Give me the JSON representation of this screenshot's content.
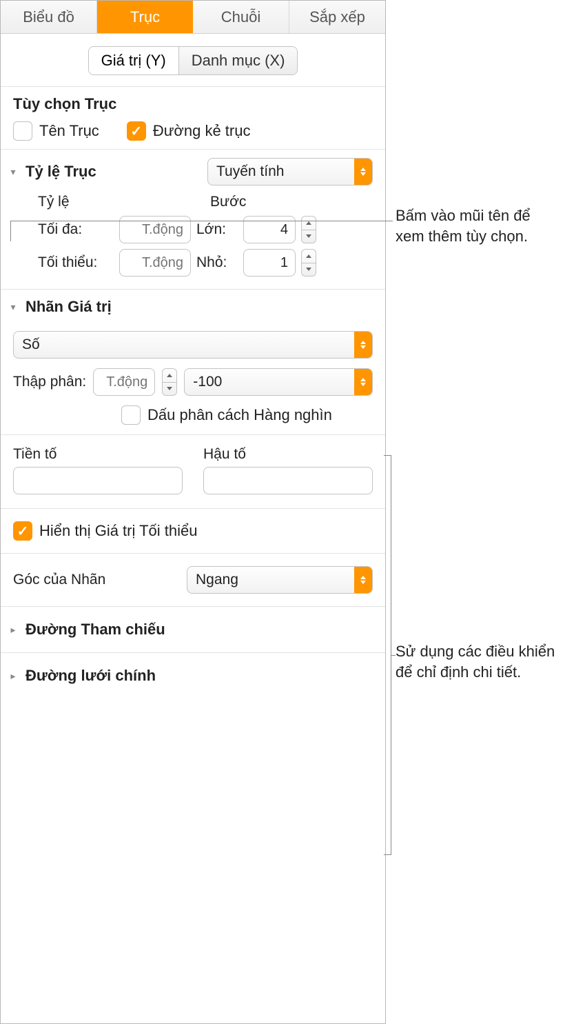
{
  "tabs": {
    "chart": "Biểu đồ",
    "axis": "Trục",
    "series": "Chuỗi",
    "sort": "Sắp xếp"
  },
  "segmented": {
    "value_y": "Giá trị (Y)",
    "category_x": "Danh mục (X)"
  },
  "axis_options": {
    "title": "Tùy chọn Trục",
    "axis_name": "Tên Trục",
    "axis_line": "Đường kẻ trục"
  },
  "axis_scale": {
    "title": "Tỷ lệ Trục",
    "scale_value": "Tuyến tính",
    "scale_head": "Tỷ lệ",
    "step_head": "Bước",
    "max": "Tối đa:",
    "min": "Tối thiểu:",
    "auto_placeholder": "T.động",
    "major": "Lớn:",
    "minor": "Nhỏ:",
    "major_val": "4",
    "minor_val": "1"
  },
  "value_labels": {
    "title": "Nhãn Giá trị",
    "format": "Số",
    "decimals_label": "Thập phân:",
    "decimals_placeholder": "T.động",
    "neg_format": "-100",
    "thousands": "Dấu phân cách Hàng nghìn",
    "prefix": "Tiền tố",
    "suffix": "Hậu tố",
    "show_min": "Hiển thị Giá trị Tối thiểu",
    "label_angle": "Góc của Nhãn",
    "angle_value": "Ngang"
  },
  "reference_lines": "Đường Tham chiếu",
  "main_gridlines": "Đường lưới chính",
  "annotations": {
    "arrow_tip": "Bấm vào mũi tên để xem thêm tùy chọn.",
    "controls_tip": "Sử dụng các điều khiển để chỉ định chi tiết."
  }
}
